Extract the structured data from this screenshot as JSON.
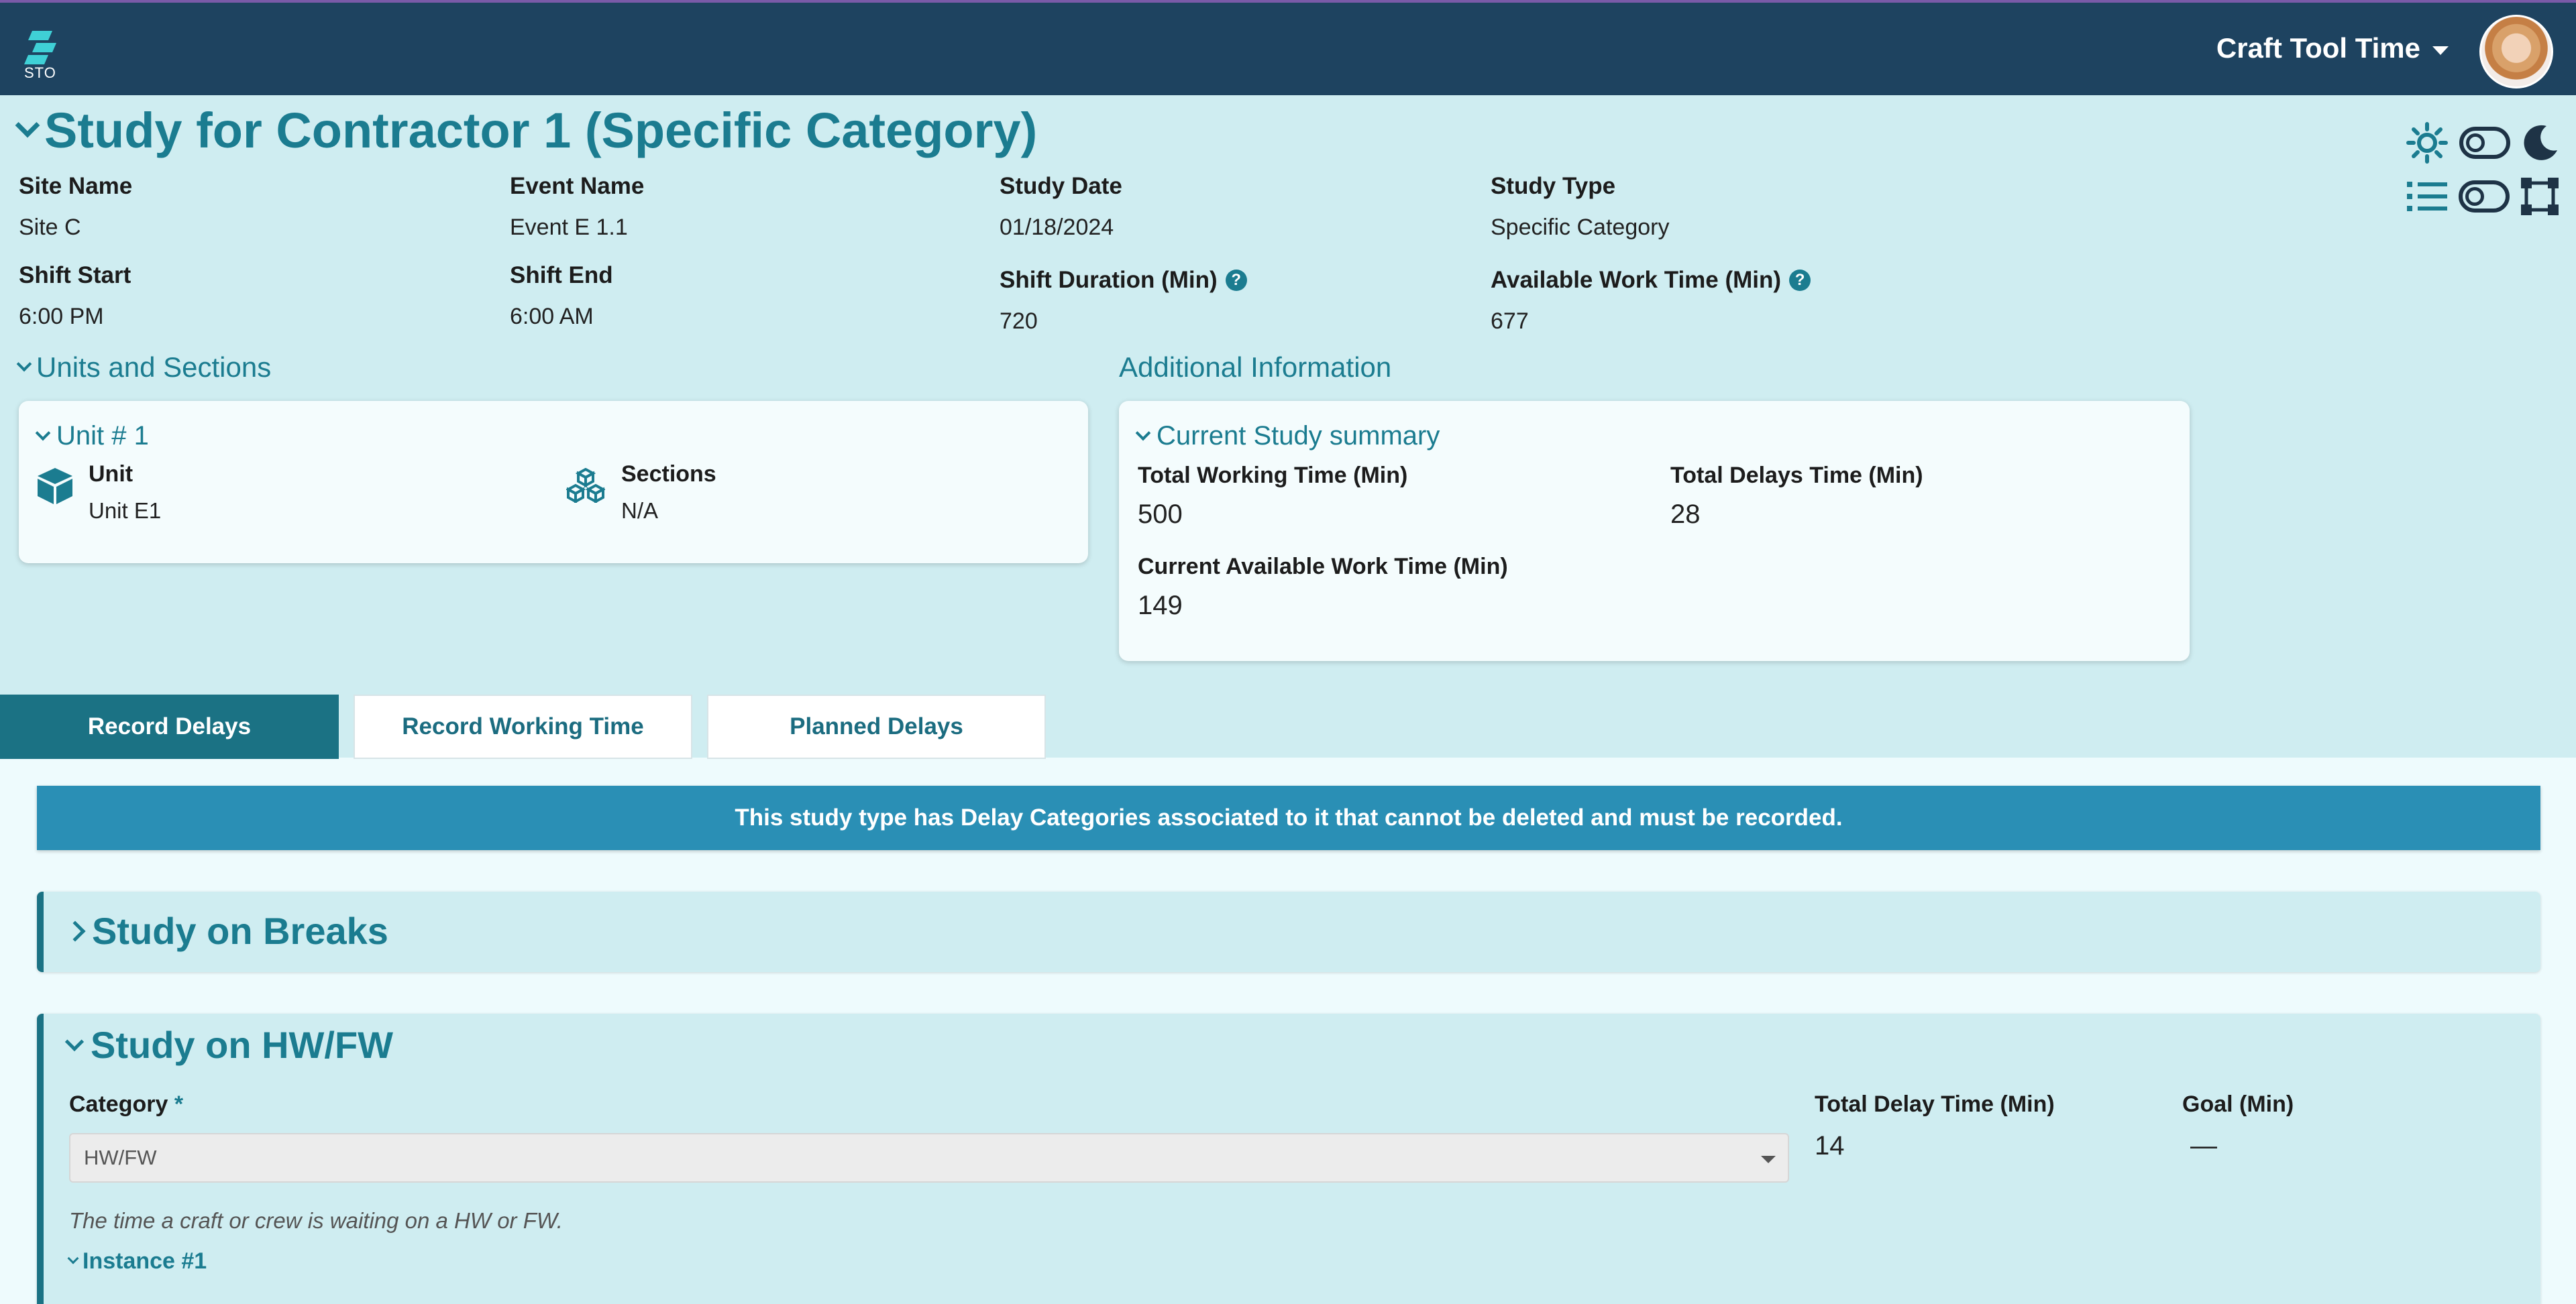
{
  "app": {
    "logo_text": "STO",
    "user_menu_label": "Craft Tool Time"
  },
  "study": {
    "title": "Study for Contractor 1 (Specific Category)",
    "fields": {
      "site_name_label": "Site Name",
      "site_name": "Site C",
      "event_name_label": "Event Name",
      "event_name": "Event E 1.1",
      "study_date_label": "Study Date",
      "study_date": "01/18/2024",
      "study_type_label": "Study Type",
      "study_type": "Specific Category",
      "shift_start_label": "Shift Start",
      "shift_start": "6:00 PM",
      "shift_end_label": "Shift End",
      "shift_end": "6:00 AM",
      "shift_duration_label": "Shift Duration (Min)",
      "shift_duration": "720",
      "available_work_time_label": "Available Work Time (Min)",
      "available_work_time": "677"
    }
  },
  "units": {
    "section_title": "Units and Sections",
    "card_title": "Unit # 1",
    "unit_label": "Unit",
    "unit_value": "Unit E1",
    "sections_label": "Sections",
    "sections_value": "N/A"
  },
  "additional": {
    "section_title": "Additional Information",
    "card_title": "Current Study summary",
    "total_working_label": "Total Working Time (Min)",
    "total_working": "500",
    "total_delays_label": "Total Delays Time (Min)",
    "total_delays": "28",
    "current_available_label": "Current Available Work Time (Min)",
    "current_available": "149"
  },
  "tabs": [
    {
      "label": "Record Delays",
      "active": true
    },
    {
      "label": "Record Working Time",
      "active": false
    },
    {
      "label": "Planned Delays",
      "active": false
    }
  ],
  "alert": "This study type has Delay Categories associated to it that cannot be deleted and must be recorded.",
  "panels": {
    "breaks_title": "Study on Breaks",
    "hwfw_title": "Study on HW/FW",
    "category_label": "Category",
    "required_mark": "*",
    "category_value": "HW/FW",
    "total_delay_label": "Total Delay Time (Min)",
    "total_delay": "14",
    "goal_label": "Goal (Min)",
    "goal": "—",
    "description": "The time a craft or crew is waiting on a HW or FW.",
    "instance_label": "Instance #1"
  },
  "icons": [
    "sun-icon",
    "theme-toggle",
    "moon-icon",
    "list-icon",
    "view-toggle",
    "fullscreen-icon",
    "cube-icon",
    "cubes-icon",
    "help-icon"
  ],
  "colors": {
    "nav": "#1e4360",
    "accent": "#1b7c90",
    "tab_active": "#1b7284",
    "alert": "#2a8fb5",
    "page_bg": "#cfedf1"
  }
}
